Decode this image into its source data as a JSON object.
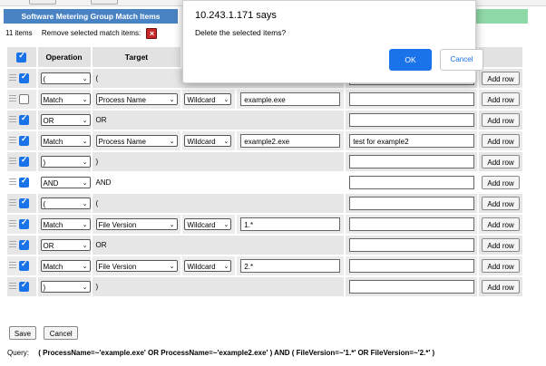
{
  "header": {
    "title": "Software Metering Group Match Items"
  },
  "summary": {
    "count": "11 items",
    "remove_label": "Remove selected match items:",
    "remove_icon": "delete-x-icon"
  },
  "columns": {
    "operation": "Operation",
    "target": "Target"
  },
  "rows": [
    {
      "checked": true,
      "operation": "(",
      "text": "("
    },
    {
      "checked": false,
      "operation": "Match",
      "target": "Process Name",
      "match_type": "Wildcard",
      "value": "example.exe",
      "description": ""
    },
    {
      "checked": true,
      "operation": "OR",
      "text": "OR"
    },
    {
      "checked": true,
      "operation": "Match",
      "target": "Process Name",
      "match_type": "Wildcard",
      "value": "example2.exe",
      "description": "test for example2"
    },
    {
      "checked": true,
      "operation": ")",
      "text": ")"
    },
    {
      "checked": true,
      "operation": "AND",
      "text": "AND"
    },
    {
      "checked": true,
      "operation": "(",
      "text": "("
    },
    {
      "checked": true,
      "operation": "Match",
      "target": "File Version",
      "match_type": "Wildcard",
      "value": "1.*",
      "description": ""
    },
    {
      "checked": true,
      "operation": "OR",
      "text": "OR"
    },
    {
      "checked": true,
      "operation": "Match",
      "target": "File Version",
      "match_type": "Wildcard",
      "value": "2.*",
      "description": ""
    },
    {
      "checked": true,
      "operation": ")",
      "text": ")"
    }
  ],
  "add_row_label": "Add row",
  "footer": {
    "save": "Save",
    "cancel": "Cancel"
  },
  "query": {
    "label": "Query:",
    "text": "( ProcessName=~'example.exe' OR ProcessName=~'example2.exe' ) AND ( FileVersion=~'1.*' OR FileVersion=~'2.*' )"
  },
  "dialog": {
    "title": "10.243.1.171 says",
    "message": "Delete the selected items?",
    "ok": "OK",
    "cancel": "Cancel"
  }
}
